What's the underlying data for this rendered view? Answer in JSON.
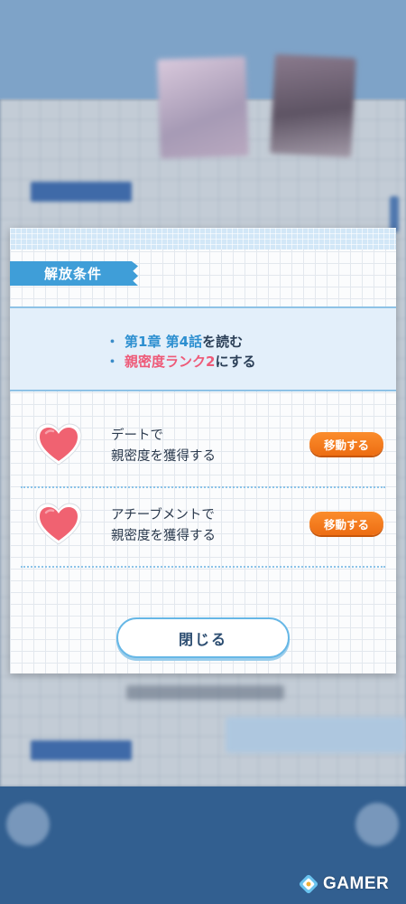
{
  "modal": {
    "section_title": "解放条件",
    "conditions": [
      {
        "highlight": "第1章 第4話",
        "suffix": "を読む",
        "color": "#2d8fd0"
      },
      {
        "highlight": "親密度ランク2",
        "suffix": "にする",
        "color": "#ee5a78"
      }
    ],
    "routes": [
      {
        "line1": "デートで",
        "line2": "親密度を獲得する",
        "button": "移動する",
        "icon": "heart-icon"
      },
      {
        "line1": "アチーブメントで",
        "line2": "親密度を獲得する",
        "button": "移動する",
        "icon": "heart-icon"
      }
    ],
    "close_label": "閉じる"
  },
  "watermark": {
    "text": "GAMER"
  },
  "colors": {
    "accent_blue": "#3f9ed8",
    "accent_orange": "#f07a1f",
    "heart": "#f06271",
    "highlight_pink": "#ee5a78"
  }
}
